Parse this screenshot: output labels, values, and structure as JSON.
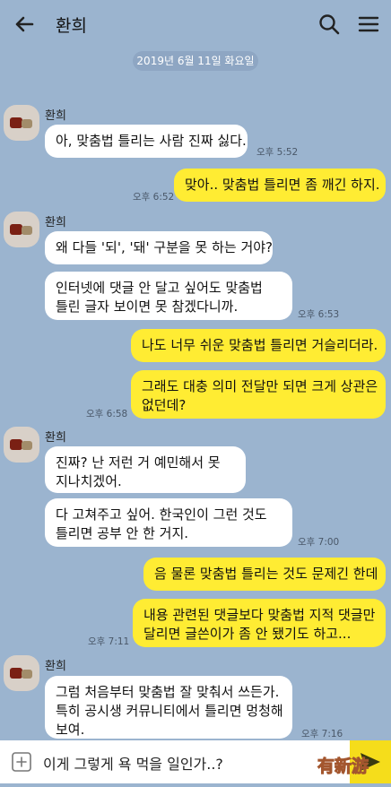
{
  "header": {
    "title": "환희"
  },
  "date_divider": "2019년 6월 11일 화요일",
  "groups": [
    {
      "sender": "환희"
    },
    {
      "sender": "환희"
    },
    {
      "sender": "환희"
    },
    {
      "sender": "환희"
    }
  ],
  "messages": [
    {
      "text": "아, 맞춤법 틀리는 사람 진짜 싫다.",
      "time": "오후 5:52"
    },
    {
      "text": "맞아.. 맞춤법 틀리면 좀 깨긴 하지.",
      "time": "오후 6:52"
    },
    {
      "text": "왜 다들 '되', '돼' 구분을 못 하는 거야?"
    },
    {
      "line1": "인터넷에 댓글 안 달고 싶어도 맞춤법",
      "line2": "틀린 글자 보이면 못 참겠다니까.",
      "time": "오후 6:53"
    },
    {
      "text": "나도 너무 쉬운 맞춤법 틀리면 거슬리더라."
    },
    {
      "line1": "그래도 대충 의미 전달만 되면 크게 상관은",
      "line2": "없던데?",
      "time": "오후 6:58"
    },
    {
      "line1": "진짜? 난 저런 거 예민해서 못",
      "line2": "지나치겠어."
    },
    {
      "line1": "다 고쳐주고 싶어. 한국인이 그런 것도",
      "line2": "틀리면 공부 안 한 거지.",
      "time": "오후 7:00"
    },
    {
      "text": "음 물론 맞춤법 틀리는 것도 문제긴 한데"
    },
    {
      "line1": "내용 관련된 댓글보다 맞춤법 지적 댓글만",
      "line2": "달리면 글쓴이가 좀 안 됐기도 하고...",
      "time": "오후 7:11"
    },
    {
      "line1": "그럼 처음부터 맞춤법 잘 맞춰서 쓰든가.",
      "line2": "특히 공시생 커뮤니티에서 틀리면 멍청해",
      "line3": "보여.",
      "time": "오후 7:16"
    }
  ],
  "input": {
    "value": "이게 그렇게 욕 먹을 일인가..?"
  },
  "watermark": "有新游",
  "colors": {
    "background": "#9bb4cf",
    "incoming": "#ffffff",
    "outgoing": "#ffec33"
  }
}
